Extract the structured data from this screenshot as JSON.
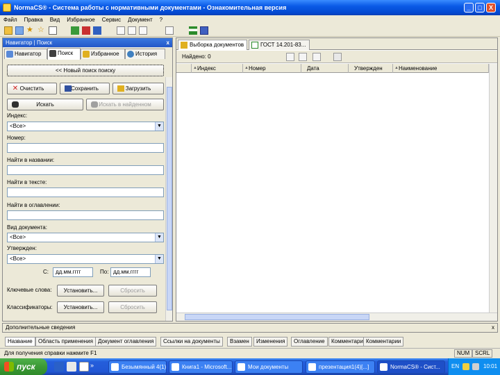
{
  "window": {
    "title": "NormaCS® - Система работы с нормативными документами - Ознакомительная версия",
    "minimize": "_",
    "maximize": "□",
    "close": "X"
  },
  "menu": [
    "Файл",
    "Правка",
    "Вид",
    "Избранное",
    "Сервис",
    "Документ",
    "?"
  ],
  "left_panel": {
    "title": "Навигатор | Поиск",
    "close": "x",
    "tabs": [
      "Навигатор",
      "Поиск",
      "Избранное",
      "История"
    ],
    "new_search": "<< Новый поиск поиску",
    "clear": "Очистить",
    "save": "Сохранить",
    "load": "Загрузить",
    "search": "Искать",
    "search_in_found": "Искать в найденном",
    "fields": {
      "index_label": "Индекс:",
      "index_value": "<Все>",
      "number_label": "Номер:",
      "title_label": "Найти в названии:",
      "text_label": "Найти в тексте:",
      "toc_label": "Найти в оглавлении:",
      "doctype_label": "Вид документа:",
      "doctype_value": "<Все>",
      "approved_label": "Утвержден:",
      "approved_value": "<Все>"
    },
    "date_from_label": "С:",
    "date_from": "дд.мм.гггг",
    "date_to_label": "По:",
    "date_to": "дд.мм.гггг",
    "keywords_label": "Ключевые слова:",
    "keywords_set": "Установить...",
    "keywords_reset": "Сбросить",
    "classifier_label": "Классификаторы:",
    "classifier_set": "Установить...",
    "classifier_reset": "Сбросить"
  },
  "right_panel": {
    "tabs": [
      "Выборка документов",
      "ГОСТ 14.201-83..."
    ],
    "found": "Найдено: 0",
    "columns": [
      "Индекс",
      "Номер",
      "Дата",
      "Утвержден",
      "Наименование"
    ]
  },
  "bottom": {
    "additional_info": "Дополнительные сведения",
    "close": "x",
    "tabs": [
      "Название",
      "Область применения",
      "Документ оглавления",
      "Ссылки на документы",
      "Взамен",
      "Изменения",
      "Оглавление",
      "Комментарии",
      "Комментарии"
    ]
  },
  "statusbar": {
    "text": "Для получения справки нажмите F1",
    "num": "NUM",
    "scrl": "SCRL"
  },
  "taskbar": {
    "start": "пуск",
    "tasks": [
      "Безымянный 4(1)[...]",
      "Книга1 - Microsoft...",
      "Мои документы",
      "презентация1(4)[...]",
      "NormaCS® - Сист..."
    ],
    "lang": "EN",
    "time": "10:01"
  },
  "colors": {
    "title_bar": "#0a5ae6",
    "taskbar": "#245edb",
    "start": "#3c9a36",
    "face": "#ece9d8"
  }
}
